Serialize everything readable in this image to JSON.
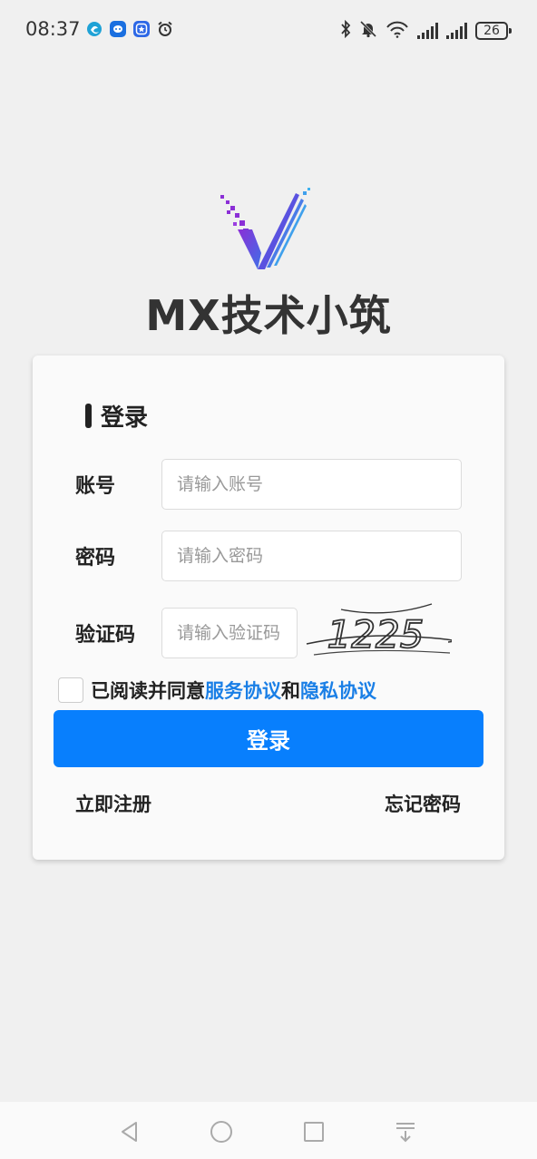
{
  "status_bar": {
    "time": "08:37",
    "left_icons": [
      "edge-browser-icon",
      "messenger-icon",
      "app-badge-icon",
      "alarm-icon"
    ],
    "right_icons": [
      "bluetooth-icon",
      "mute-bell-icon",
      "wifi-6-icon",
      "signal-icon",
      "signal-icon"
    ],
    "battery": "26"
  },
  "brand": {
    "name": "MX技术小筑",
    "logo_icon": "v-logo-icon",
    "colors": {
      "logo_start": "#8b2fd6",
      "logo_end": "#3f6fe8"
    }
  },
  "login_card": {
    "title": "登录",
    "account": {
      "label": "账号",
      "placeholder": "请输入账号",
      "value": ""
    },
    "password": {
      "label": "密码",
      "placeholder": "请输入密码",
      "value": ""
    },
    "captcha": {
      "label": "验证码",
      "placeholder": "请输入验证码",
      "value": "",
      "image_text": "1225"
    },
    "agreement": {
      "checked": false,
      "prefix": "已阅读并同意",
      "service_link": "服务协议",
      "conjunction": "和",
      "privacy_link": "隐私协议"
    },
    "submit_label": "登录",
    "register_label": "立即注册",
    "forgot_label": "忘记密码"
  },
  "colors": {
    "primary": "#087ffd",
    "link": "#1a7fe6",
    "background": "#f0f0f0"
  },
  "nav_bar": {
    "icons": [
      "back-triangle-icon",
      "home-circle-icon",
      "recents-square-icon",
      "notification-pull-icon"
    ]
  }
}
